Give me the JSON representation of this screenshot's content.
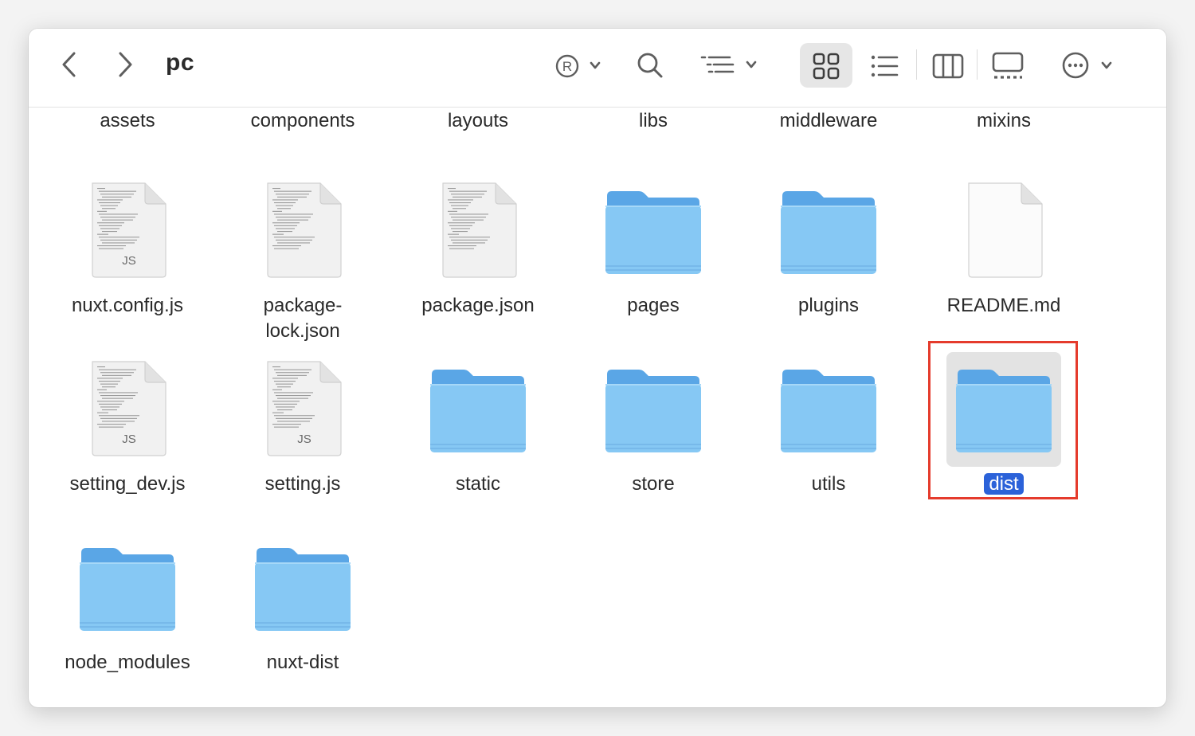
{
  "window": {
    "title": "pc"
  },
  "toolbar": {
    "back_icon": "chevron-left-icon",
    "forward_icon": "chevron-right-icon",
    "tags_icon": "registered-circle-icon",
    "search_icon": "search-icon",
    "group_icon": "group-list-icon",
    "view_icons": [
      "icon-view-grid",
      "list-view",
      "column-view",
      "gallery-view"
    ],
    "active_view": "icon-view-grid",
    "more_icon": "ellipsis-circle-icon"
  },
  "top_row": [
    "assets",
    "components",
    "layouts",
    "libs",
    "middleware",
    "mixins"
  ],
  "items": [
    {
      "name": "nuxt.config.js",
      "type": "js"
    },
    {
      "name": "package-lock.json",
      "line1": "package-",
      "line2": "lock.json",
      "type": "text"
    },
    {
      "name": "package.json",
      "type": "text"
    },
    {
      "name": "pages",
      "type": "folder"
    },
    {
      "name": "plugins",
      "type": "folder"
    },
    {
      "name": "README.md",
      "type": "blank"
    },
    {
      "name": "setting_dev.js",
      "type": "js"
    },
    {
      "name": "setting.js",
      "type": "js"
    },
    {
      "name": "static",
      "type": "folder"
    },
    {
      "name": "store",
      "type": "folder"
    },
    {
      "name": "utils",
      "type": "folder"
    },
    {
      "name": "dist",
      "type": "folder",
      "selected": true
    },
    {
      "name": "node_modules",
      "type": "folder"
    },
    {
      "name": "nuxt-dist",
      "type": "folder"
    }
  ],
  "js_badge": "JS",
  "colors": {
    "folder_back": "#5aa6e6",
    "folder_front": "#86c8f4",
    "selection": "#2b62d9",
    "annotation": "#e53b2c"
  }
}
